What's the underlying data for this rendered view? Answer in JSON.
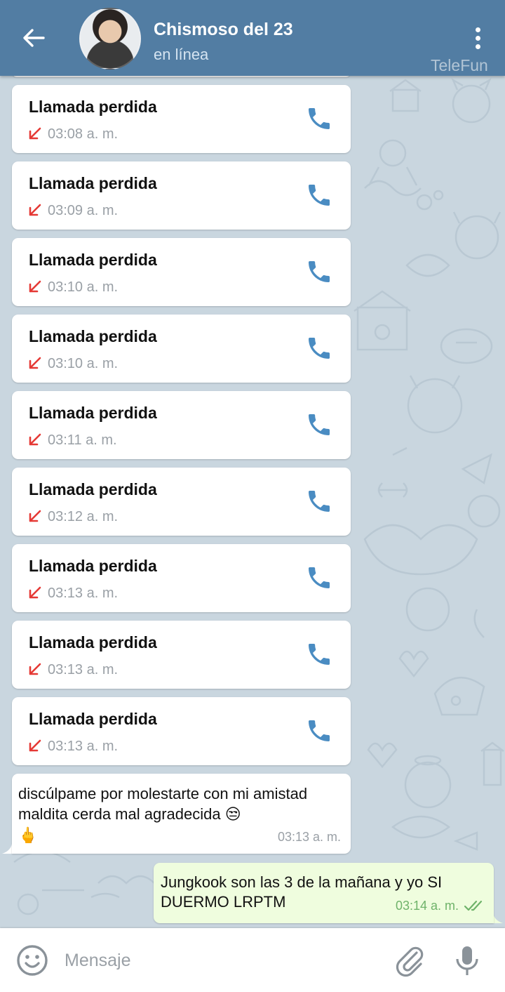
{
  "header": {
    "title": "Chismoso del 23",
    "status": "en línea",
    "watermark": "TeleFun",
    "colors": {
      "bar": "#527da3",
      "status_text": "#d5e4f1"
    },
    "icons": {
      "back": "arrow-left-icon",
      "menu": "more-vertical-icon"
    }
  },
  "calls": [
    {
      "title": "Llamada perdida",
      "time": "03:08 a. m."
    },
    {
      "title": "Llamada perdida",
      "time": "03:09 a. m."
    },
    {
      "title": "Llamada perdida",
      "time": "03:10 a. m."
    },
    {
      "title": "Llamada perdida",
      "time": "03:10 a. m."
    },
    {
      "title": "Llamada perdida",
      "time": "03:11 a. m."
    },
    {
      "title": "Llamada perdida",
      "time": "03:12 a. m."
    },
    {
      "title": "Llamada perdida",
      "time": "03:13 a. m."
    },
    {
      "title": "Llamada perdida",
      "time": "03:13 a. m."
    },
    {
      "title": "Llamada perdida",
      "time": "03:13 a. m."
    }
  ],
  "call_colors": {
    "missed_arrow": "#e53935",
    "phone_icon": "#4a8cc2"
  },
  "incoming_message": {
    "text": "discúlpame por molestarte con mi amistad maldita cerda mal agradecida",
    "emoji_1": "😒",
    "emoji_2": "🖕",
    "time": "03:13 a. m."
  },
  "outgoing_message": {
    "text": "Jungkook son las 3 de la mañana y yo SI DUERMO LRPTM",
    "time": "03:14 a. m.",
    "status": "read",
    "colors": {
      "bubble": "#effdde",
      "meta": "#6fb36a"
    }
  },
  "input_bar": {
    "placeholder": "Mensaje",
    "icons": {
      "emoji": "smile-icon",
      "attach": "paperclip-icon",
      "mic": "microphone-icon"
    }
  }
}
